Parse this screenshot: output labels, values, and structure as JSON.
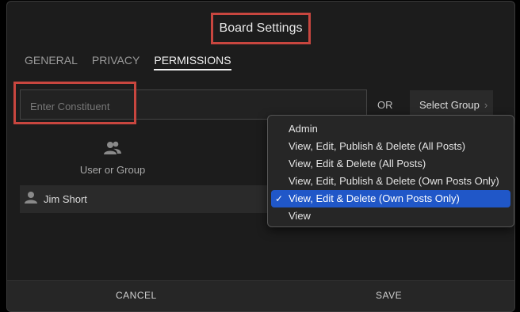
{
  "dialog": {
    "title": "Board Settings",
    "tabs": [
      {
        "label": "GENERAL"
      },
      {
        "label": "PRIVACY"
      },
      {
        "label": "PERMISSIONS"
      }
    ],
    "constituent": {
      "placeholder": "Enter Constituent",
      "value": ""
    },
    "or_label": "OR",
    "select_group_label": "Select Group",
    "users_column_label": "User or Group",
    "users": [
      {
        "name": "Jim Short"
      }
    ],
    "footer": {
      "cancel_label": "CANCEL",
      "save_label": "SAVE"
    }
  },
  "permission_menu": {
    "items": [
      {
        "label": "Admin"
      },
      {
        "label": "View, Edit, Publish & Delete (All Posts)"
      },
      {
        "label": "View, Edit & Delete (All Posts)"
      },
      {
        "label": "View, Edit, Publish & Delete (Own Posts Only)"
      },
      {
        "label": "View, Edit & Delete (Own Posts Only)"
      },
      {
        "label": "View"
      }
    ],
    "selected_label": "View, Edit & Delete (Own Posts Only)",
    "check_glyph": "✓"
  },
  "colors": {
    "highlight": "#c8463f",
    "selection": "#2057c8",
    "background": "#1c1c1c"
  }
}
